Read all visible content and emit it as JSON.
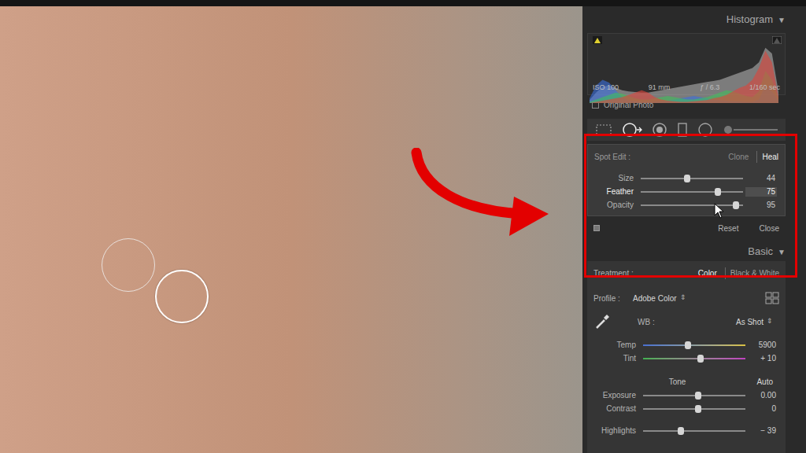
{
  "histogram": {
    "title": "Histogram",
    "toggle": "▼",
    "exif": [
      "ISO 100",
      "91 mm",
      "ƒ / 6.3",
      "1/160 sec"
    ],
    "series": [
      {
        "name": "luminance",
        "color": "#bdbdbd",
        "values": [
          5,
          18,
          28,
          30,
          26,
          22,
          20,
          19,
          18,
          18,
          20,
          22,
          24,
          26,
          28,
          30,
          32,
          34,
          36,
          38,
          40,
          44,
          48,
          52,
          56,
          60,
          70,
          95,
          85,
          20
        ]
      },
      {
        "name": "blue",
        "color": "#3b6fe0",
        "values": [
          8,
          30,
          40,
          35,
          22,
          10,
          5,
          3,
          2,
          2,
          2,
          3,
          4,
          6,
          8,
          10,
          12,
          10,
          8,
          6,
          5,
          4,
          3,
          3,
          2,
          2,
          6,
          30,
          20,
          5
        ]
      },
      {
        "name": "green",
        "color": "#3fbf5a",
        "values": [
          2,
          6,
          10,
          14,
          18,
          16,
          12,
          8,
          6,
          6,
          8,
          10,
          12,
          10,
          8,
          6,
          6,
          8,
          10,
          14,
          18,
          22,
          20,
          16,
          12,
          10,
          20,
          55,
          40,
          8
        ]
      },
      {
        "name": "red",
        "color": "#e0453a",
        "values": [
          0,
          2,
          4,
          6,
          8,
          10,
          14,
          18,
          22,
          18,
          10,
          6,
          4,
          3,
          2,
          2,
          3,
          4,
          5,
          8,
          10,
          14,
          20,
          26,
          30,
          40,
          60,
          90,
          70,
          10
        ]
      }
    ]
  },
  "original_photo": {
    "label": "Original Photo",
    "checked": false
  },
  "tools": [
    {
      "kind": "crop",
      "selected": false
    },
    {
      "kind": "spot",
      "selected": true
    },
    {
      "kind": "redeye",
      "selected": false
    },
    {
      "kind": "graduated",
      "selected": false
    },
    {
      "kind": "radial",
      "selected": false
    },
    {
      "kind": "brush",
      "selected": false
    }
  ],
  "spot_edit": {
    "label": "Spot Edit :",
    "modes": [
      {
        "label": "Clone",
        "selected": false
      },
      {
        "label": "Heal",
        "selected": true
      }
    ],
    "sliders": [
      {
        "label": "Size",
        "value": "44",
        "level": 0.45,
        "active": false,
        "kind": "plain"
      },
      {
        "label": "Feather",
        "value": "75",
        "level": 0.75,
        "active": true,
        "kind": "plain"
      },
      {
        "label": "Opacity",
        "value": "95",
        "level": 0.93,
        "active": false,
        "kind": "plain"
      }
    ],
    "buttons": [
      "Reset",
      "Close"
    ]
  },
  "basic": {
    "title": "Basic",
    "toggle": "▼",
    "treatment": {
      "label": "Treatment :",
      "options": [
        {
          "label": "Color",
          "selected": true
        },
        {
          "label": "Black & White",
          "selected": false
        }
      ]
    },
    "profile": {
      "label": "Profile :",
      "value": "Adobe Color",
      "arrows": "⇕"
    },
    "wb": {
      "label": "WB :",
      "value": "As Shot",
      "arrows": "⇕"
    },
    "wb_sliders": [
      {
        "label": "Temp",
        "value": "5900",
        "level": 0.44,
        "active": false,
        "kind": "temp"
      },
      {
        "label": "Tint",
        "value": "+ 10",
        "level": 0.56,
        "active": false,
        "kind": "tint"
      }
    ],
    "tone": {
      "label": "Tone",
      "auto": "Auto"
    },
    "tone_sliders": [
      {
        "label": "Exposure",
        "value": "0.00",
        "level": 0.54,
        "active": false,
        "kind": "plain"
      },
      {
        "label": "Contrast",
        "value": "0",
        "level": 0.54,
        "active": false,
        "kind": "plain"
      },
      {
        "label": "Highlights",
        "value": "− 39",
        "level": 0.37,
        "active": false,
        "kind": "plain"
      }
    ]
  },
  "photo": {
    "spots": [
      {
        "selected": false
      },
      {
        "selected": true
      }
    ]
  }
}
